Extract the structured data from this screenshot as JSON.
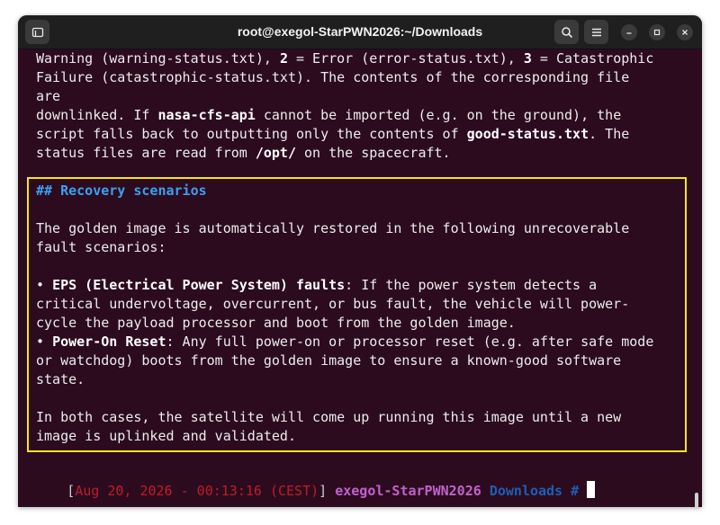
{
  "window": {
    "title": "root@exegol-StarPWN2026:~/Downloads"
  },
  "terminal": {
    "intro_lines": [
      [
        {
          "t": "Warning (warning-status.txt), "
        },
        {
          "t": "2",
          "b": true
        },
        {
          "t": " = Error (error-status.txt), "
        },
        {
          "t": "3",
          "b": true
        },
        {
          "t": " = Catastrophic"
        }
      ],
      [
        {
          "t": "Failure (catastrophic-status.txt). The contents of the corresponding file"
        }
      ],
      [
        {
          "t": "are"
        }
      ],
      [
        {
          "t": "downlinked. If "
        },
        {
          "t": "nasa-cfs-api",
          "b": true
        },
        {
          "t": " cannot be imported (e.g. on the ground), the"
        }
      ],
      [
        {
          "t": "script falls back to outputting only the contents of "
        },
        {
          "t": "good-status.txt",
          "b": true
        },
        {
          "t": ". The"
        }
      ],
      [
        {
          "t": "status files are read from "
        },
        {
          "t": "/opt/",
          "b": true
        },
        {
          "t": " on the spacecraft."
        }
      ]
    ],
    "recovery_heading": "## Recovery scenarios",
    "recovery_lines": [
      [
        {
          "t": "The golden image is automatically restored in the following unrecoverable"
        }
      ],
      [
        {
          "t": "fault scenarios:"
        }
      ],
      [
        {
          "t": ""
        }
      ],
      [
        {
          "t": "• "
        },
        {
          "t": "EPS (Electrical Power System) faults",
          "b": true
        },
        {
          "t": ": If the power system detects a"
        }
      ],
      [
        {
          "t": "critical undervoltage, overcurrent, or bus fault, the vehicle will power-"
        }
      ],
      [
        {
          "t": "cycle the payload processor and boot from the golden image."
        }
      ],
      [
        {
          "t": "• "
        },
        {
          "t": "Power-On Reset",
          "b": true
        },
        {
          "t": ": Any full power-on or processor reset (e.g. after safe mode"
        }
      ],
      [
        {
          "t": "or watchdog) boots from the golden image to ensure a known-good software"
        }
      ],
      [
        {
          "t": "state."
        }
      ],
      [
        {
          "t": ""
        }
      ],
      [
        {
          "t": "In both cases, the satellite will come up running this image until a new"
        }
      ],
      [
        {
          "t": "image is uplinked and validated."
        }
      ]
    ],
    "prompt": {
      "open_bracket": "[",
      "datetime": "Aug 20, 2026 - 00:13:16 (CEST)",
      "close_bracket": "]",
      "host": "exegol-StarPWN2026",
      "dir": "Downloads",
      "symbol": "#"
    }
  }
}
